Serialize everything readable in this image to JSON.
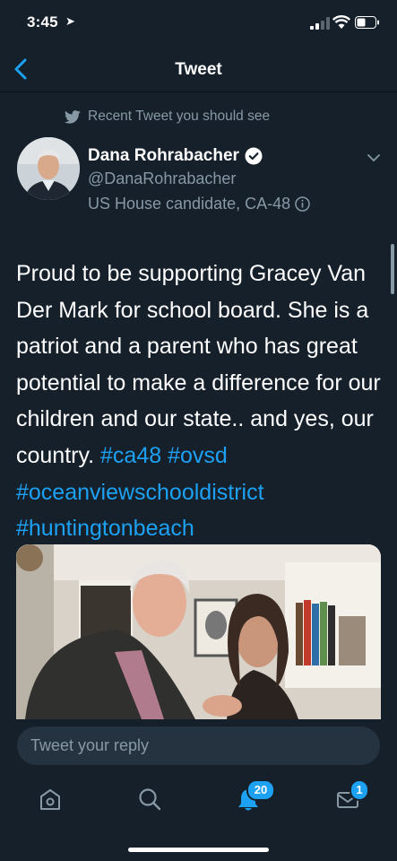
{
  "status_bar": {
    "time": "3:45"
  },
  "nav": {
    "title": "Tweet"
  },
  "context": {
    "label": "Recent Tweet you should see"
  },
  "author": {
    "name": "Dana Rohrabacher",
    "handle": "@DanaRohrabacher",
    "bio": "US House candidate, CA-48"
  },
  "tweet": {
    "text_plain": "Proud to be supporting Gracey Van Der Mark for school board. She is a patriot and a parent who has great potential to make a difference for our children and our state.. and yes, our country.",
    "hashtags": [
      "#ca48",
      "#ovsd",
      "#oceanviewschooldistrict",
      "#huntingtonbeach"
    ]
  },
  "reply": {
    "placeholder": "Tweet your reply"
  },
  "tabbar": {
    "notifications_count": "20",
    "messages_count": "1"
  },
  "colors": {
    "background": "#15202b",
    "accent": "#1da1f2",
    "secondary_text": "#8899a6"
  }
}
